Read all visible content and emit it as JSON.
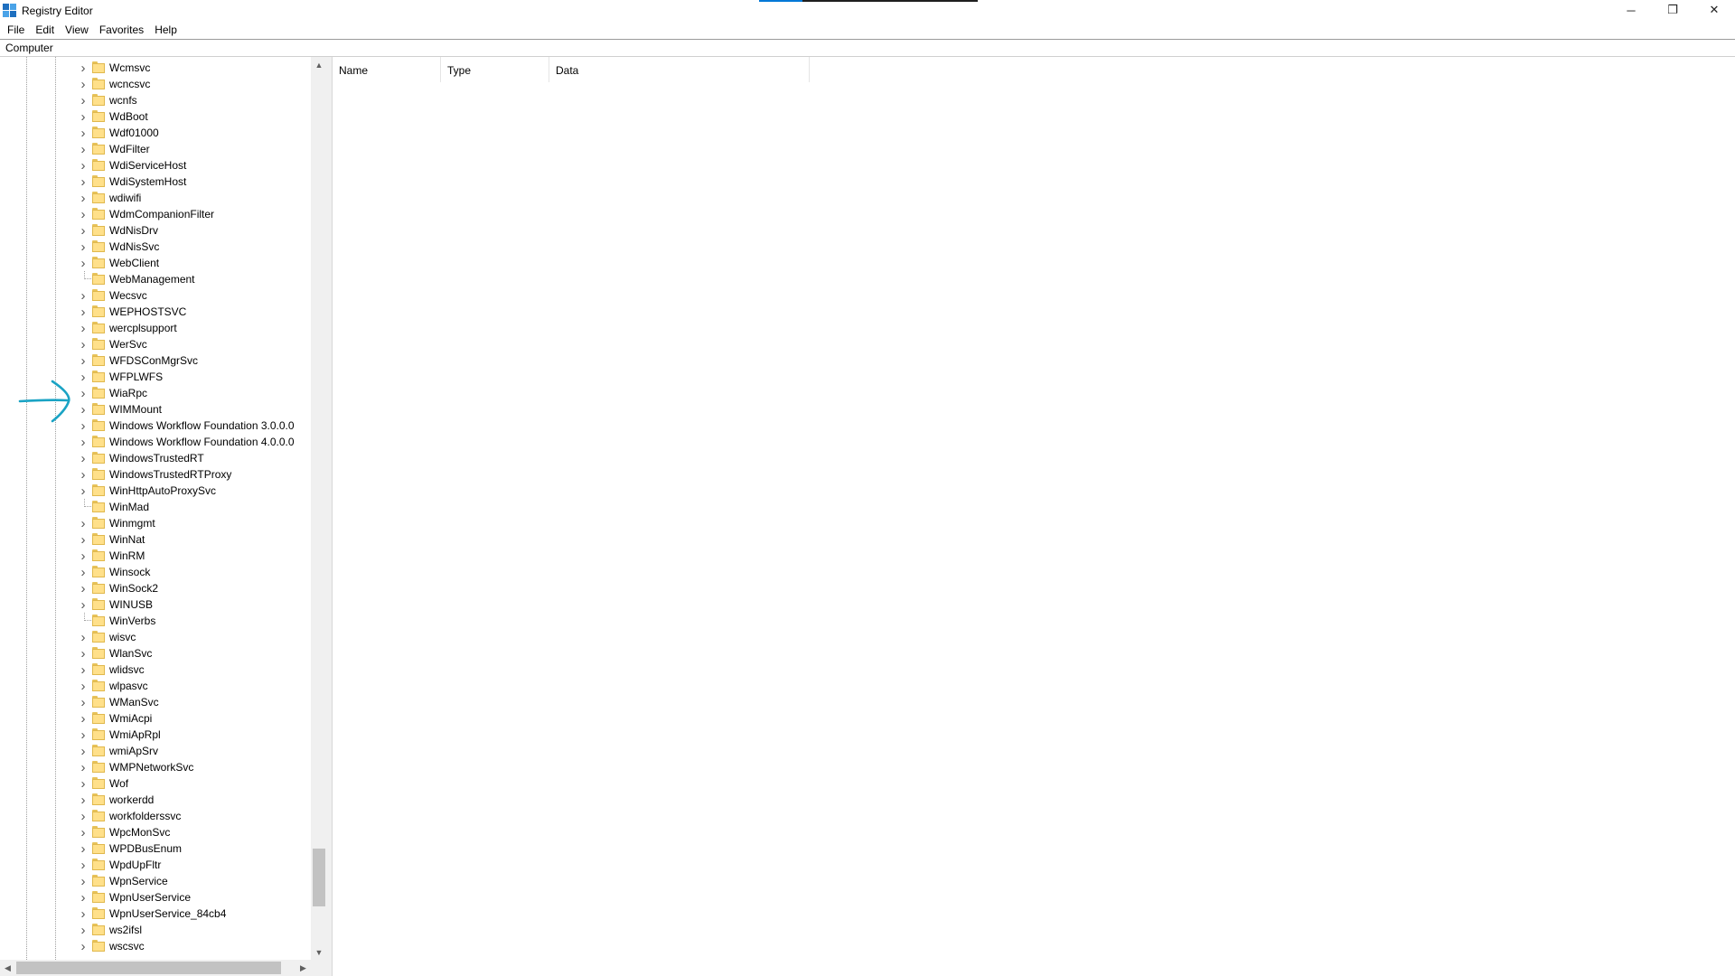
{
  "window": {
    "title": "Registry Editor",
    "icon": "registry-editor-icon",
    "controls": {
      "minimize": "─",
      "restore": "❐",
      "close": "✕"
    }
  },
  "menu": {
    "items": [
      "File",
      "Edit",
      "View",
      "Favorites",
      "Help"
    ]
  },
  "address": {
    "path": "Computer"
  },
  "tree": {
    "nodes": [
      {
        "label": "Wcmsvc",
        "expandable": true
      },
      {
        "label": "wcncsvc",
        "expandable": true
      },
      {
        "label": "wcnfs",
        "expandable": true
      },
      {
        "label": "WdBoot",
        "expandable": true
      },
      {
        "label": "Wdf01000",
        "expandable": true
      },
      {
        "label": "WdFilter",
        "expandable": true
      },
      {
        "label": "WdiServiceHost",
        "expandable": true
      },
      {
        "label": "WdiSystemHost",
        "expandable": true
      },
      {
        "label": "wdiwifi",
        "expandable": true
      },
      {
        "label": "WdmCompanionFilter",
        "expandable": true
      },
      {
        "label": "WdNisDrv",
        "expandable": true
      },
      {
        "label": "WdNisSvc",
        "expandable": true
      },
      {
        "label": "WebClient",
        "expandable": true
      },
      {
        "label": "WebManagement",
        "expandable": false
      },
      {
        "label": "Wecsvc",
        "expandable": true
      },
      {
        "label": "WEPHOSTSVC",
        "expandable": true
      },
      {
        "label": "wercplsupport",
        "expandable": true
      },
      {
        "label": "WerSvc",
        "expandable": true
      },
      {
        "label": "WFDSConMgrSvc",
        "expandable": true
      },
      {
        "label": "WFPLWFS",
        "expandable": true
      },
      {
        "label": "WiaRpc",
        "expandable": true
      },
      {
        "label": "WIMMount",
        "expandable": true
      },
      {
        "label": "Windows Workflow Foundation 3.0.0.0",
        "expandable": true
      },
      {
        "label": "Windows Workflow Foundation 4.0.0.0",
        "expandable": true
      },
      {
        "label": "WindowsTrustedRT",
        "expandable": true
      },
      {
        "label": "WindowsTrustedRTProxy",
        "expandable": true
      },
      {
        "label": "WinHttpAutoProxySvc",
        "expandable": true
      },
      {
        "label": "WinMad",
        "expandable": false
      },
      {
        "label": "Winmgmt",
        "expandable": true
      },
      {
        "label": "WinNat",
        "expandable": true
      },
      {
        "label": "WinRM",
        "expandable": true
      },
      {
        "label": "Winsock",
        "expandable": true
      },
      {
        "label": "WinSock2",
        "expandable": true
      },
      {
        "label": "WINUSB",
        "expandable": true
      },
      {
        "label": "WinVerbs",
        "expandable": false
      },
      {
        "label": "wisvc",
        "expandable": true
      },
      {
        "label": "WlanSvc",
        "expandable": true
      },
      {
        "label": "wlidsvc",
        "expandable": true
      },
      {
        "label": "wlpasvc",
        "expandable": true
      },
      {
        "label": "WManSvc",
        "expandable": true
      },
      {
        "label": "WmiAcpi",
        "expandable": true
      },
      {
        "label": "WmiApRpl",
        "expandable": true
      },
      {
        "label": "wmiApSrv",
        "expandable": true
      },
      {
        "label": "WMPNetworkSvc",
        "expandable": true
      },
      {
        "label": "Wof",
        "expandable": true
      },
      {
        "label": "workerdd",
        "expandable": true
      },
      {
        "label": "workfolderssvc",
        "expandable": true
      },
      {
        "label": "WpcMonSvc",
        "expandable": true
      },
      {
        "label": "WPDBusEnum",
        "expandable": true
      },
      {
        "label": "WpdUpFltr",
        "expandable": true
      },
      {
        "label": "WpnService",
        "expandable": true
      },
      {
        "label": "WpnUserService",
        "expandable": true
      },
      {
        "label": "WpnUserService_84cb4",
        "expandable": true
      },
      {
        "label": "ws2ifsl",
        "expandable": true
      },
      {
        "label": "wscsvc",
        "expandable": true
      }
    ]
  },
  "values": {
    "columns": [
      "Name",
      "Type",
      "Data"
    ]
  },
  "scrollbars": {
    "vertical_up": "▲",
    "vertical_down": "▼",
    "horizontal_left": "◀",
    "horizontal_right": "▶"
  },
  "annotation": {
    "color": "#1aa3c4",
    "icon": "hand-drawn-arrow-icon"
  }
}
